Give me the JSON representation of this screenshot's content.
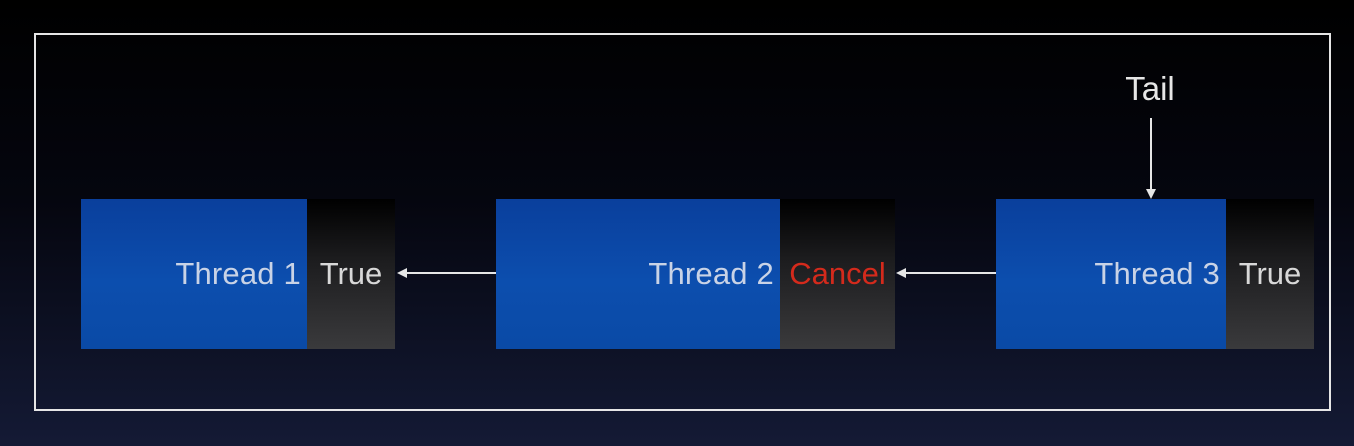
{
  "diagram": {
    "tail_label": "Tail",
    "nodes": [
      {
        "label": "Thread 1",
        "flag": "True"
      },
      {
        "label": "Thread 2",
        "flag": "Cancel"
      },
      {
        "label": "Thread 3",
        "flag": "True"
      }
    ],
    "colors": {
      "node_blue": "#0c4eae",
      "cancel_red": "#d42a1c",
      "line": "#e6e6e6"
    }
  }
}
